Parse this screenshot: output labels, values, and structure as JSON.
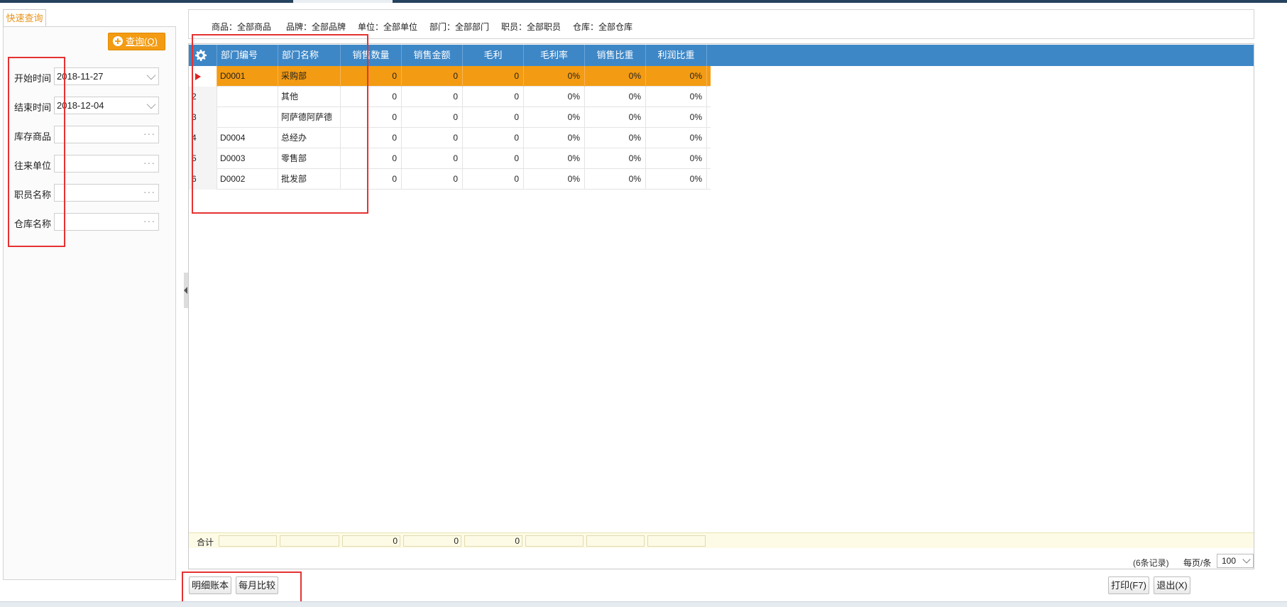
{
  "left_panel": {
    "tab_label": "快速查询",
    "query_button": "查询(Q)",
    "fields": [
      {
        "label": "开始时间",
        "value": "2018-11-27",
        "kind": "date"
      },
      {
        "label": "结束时间",
        "value": "2018-12-04",
        "kind": "date"
      },
      {
        "label": "库存商品",
        "value": "",
        "kind": "picker"
      },
      {
        "label": "往来单位",
        "value": "",
        "kind": "picker"
      },
      {
        "label": "职员名称",
        "value": "",
        "kind": "picker"
      },
      {
        "label": "仓库名称",
        "value": "",
        "kind": "picker"
      }
    ],
    "more_glyph": "···"
  },
  "filters": [
    "商品：全部商品",
    "品牌：全部品牌",
    "单位：全部单位",
    "部门：全部部门",
    "职员：全部职员",
    "仓库：全部仓库"
  ],
  "grid": {
    "columns": [
      "部门编号",
      "部门名称",
      "销售数量",
      "销售金额",
      "毛利",
      "毛利率",
      "销售比重",
      "利润比重"
    ],
    "rows": [
      {
        "index": "",
        "selected": true,
        "cells": [
          "D0001",
          "采购部",
          "0",
          "0",
          "0",
          "0%",
          "0%",
          "0%"
        ]
      },
      {
        "index": "2",
        "selected": false,
        "cells": [
          "",
          "其他",
          "0",
          "0",
          "0",
          "0%",
          "0%",
          "0%"
        ]
      },
      {
        "index": "3",
        "selected": false,
        "cells": [
          "",
          "阿萨德阿萨德",
          "0",
          "0",
          "0",
          "0%",
          "0%",
          "0%"
        ]
      },
      {
        "index": "4",
        "selected": false,
        "cells": [
          "D0004",
          "总经办",
          "0",
          "0",
          "0",
          "0%",
          "0%",
          "0%"
        ]
      },
      {
        "index": "5",
        "selected": false,
        "cells": [
          "D0003",
          "零售部",
          "0",
          "0",
          "0",
          "0%",
          "0%",
          "0%"
        ]
      },
      {
        "index": "6",
        "selected": false,
        "cells": [
          "D0002",
          "批发部",
          "0",
          "0",
          "0",
          "0%",
          "0%",
          "0%"
        ]
      }
    ],
    "total": {
      "label": "合计",
      "cells": [
        "",
        "",
        "0",
        "0",
        "0",
        "",
        "",
        ""
      ]
    }
  },
  "pager": {
    "count_text": "(6条记录)",
    "per_page_label": "每页/条",
    "per_page_value": "100"
  },
  "buttons": {
    "detail_ledger": "明细账本",
    "monthly_compare": "每月比较",
    "print": "打印(F7)",
    "exit": "退出(X)"
  },
  "colors": {
    "header_blue": "#3d87c7",
    "selected_row": "#f39b12",
    "query_button": "#f39b12",
    "annotation_red": "#e53232"
  }
}
